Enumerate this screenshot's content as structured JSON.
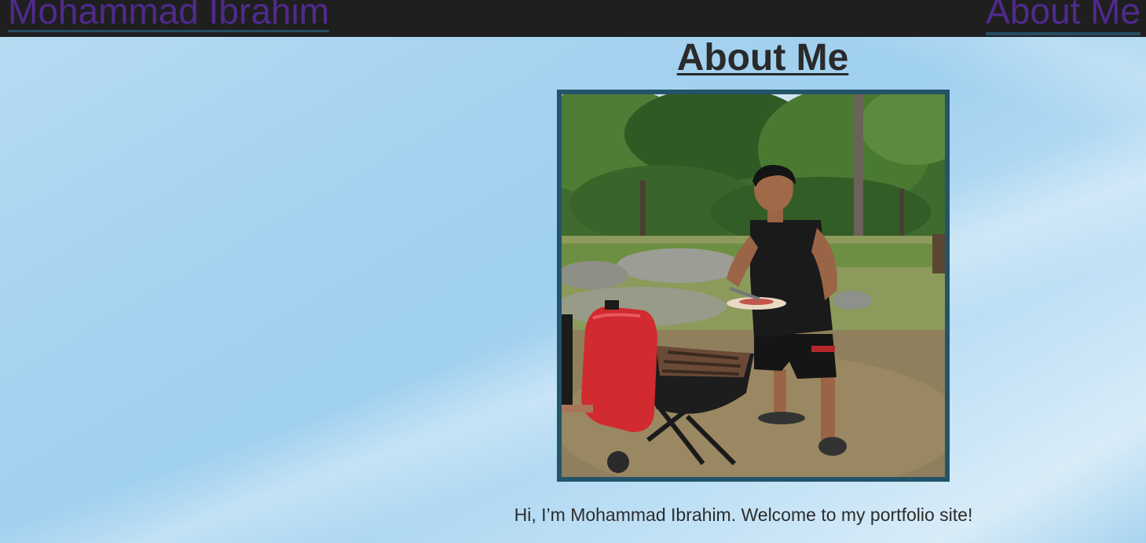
{
  "header": {
    "brand": "Mohammad Ibrahim",
    "nav_about": "About Me"
  },
  "main": {
    "title": "About Me",
    "photo_alt": "Mohammad Ibrahim grilling at a park barbecue",
    "intro": "Hi, I’m Mohammad Ibrahim. Welcome to my portfolio site!"
  },
  "colors": {
    "topbar_bg": "#1f1f1f",
    "link": "#4f2a8e",
    "frame_border": "#24546a",
    "text": "#2a2a2a"
  },
  "icons": {
    "photo": "profile-photo"
  }
}
